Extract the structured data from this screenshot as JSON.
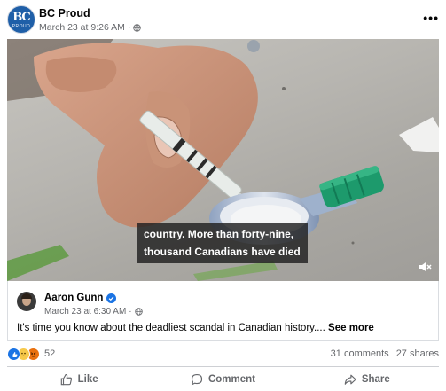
{
  "post": {
    "page_name": "BC Proud",
    "avatar_text_top": "BC",
    "avatar_text_bottom": "PROUD",
    "timestamp": "March 23 at 9:26 AM",
    "separator": "·",
    "audience_icon": "globe-icon",
    "more_label": "•••"
  },
  "video": {
    "caption_line1": "country. More than forty-nine,",
    "caption_line2": "thousand Canadians have died",
    "mute_icon": "speaker-muted-icon"
  },
  "shared": {
    "author": "Aaron Gunn",
    "verified_icon": "verified-badge-icon",
    "timestamp": "March 23 at 6:30 AM",
    "separator": "·",
    "text": "It's time you know about the deadliest scandal in Canadian history....",
    "see_more": "See more"
  },
  "engagement": {
    "reaction_icons": [
      "like-reaction-icon",
      "sad-reaction-icon",
      "angry-reaction-icon"
    ],
    "reaction_count": "52",
    "comments": "31 comments",
    "shares": "27 shares"
  },
  "actions": {
    "like": "Like",
    "comment": "Comment",
    "share": "Share"
  },
  "colors": {
    "accent": "#1b74e4",
    "secondary_text": "#65676b",
    "cap_green": "#1d9a6c"
  }
}
